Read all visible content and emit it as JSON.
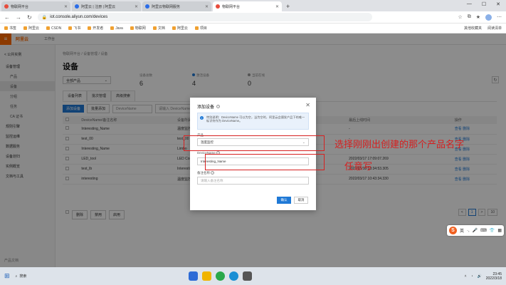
{
  "browser": {
    "tabs": [
      {
        "title": "物联网平台",
        "active": false
      },
      {
        "title": "阿里云 | 注册 | 阿里云",
        "active": false
      },
      {
        "title": "阿里云物联网服务",
        "active": false
      },
      {
        "title": "物联网平台",
        "active": true
      }
    ],
    "url": "iot.console.aliyun.com/devices",
    "bookmarks": [
      "书签",
      "阿里云",
      "CSDN",
      "飞书",
      "开发者",
      "Java",
      "物联网",
      "文档",
      "阿里云",
      "项目"
    ],
    "other_bookmarks": "其他收藏夹",
    "reading_list": "阅读清单"
  },
  "console": {
    "logo": "阿里云",
    "workspace": "工作台"
  },
  "sidebar": {
    "back": "< 公共实例",
    "items": [
      {
        "label": "设备管理",
        "sub": false,
        "active": false
      },
      {
        "label": "产品",
        "sub": true,
        "active": false
      },
      {
        "label": "设备",
        "sub": true,
        "active": true
      },
      {
        "label": "分组",
        "sub": true,
        "active": false
      },
      {
        "label": "任务",
        "sub": true,
        "active": false
      },
      {
        "label": "CA 证书",
        "sub": true,
        "active": false
      },
      {
        "label": "规则引擎",
        "sub": false,
        "active": false
      },
      {
        "label": "监控运维",
        "sub": false,
        "active": false
      },
      {
        "label": "数据服务",
        "sub": false,
        "active": false
      },
      {
        "label": "设备划归",
        "sub": false,
        "active": false
      },
      {
        "label": "实例概览",
        "sub": false,
        "active": false
      },
      {
        "label": "文档与工具",
        "sub": false,
        "active": false
      }
    ],
    "footer": "产品文档"
  },
  "page": {
    "breadcrumb": "物联网平台 / 设备管理 / 设备",
    "title": "设备",
    "product_select": "全部产品",
    "stats": [
      {
        "label": "设备总数",
        "value": "6"
      },
      {
        "label": "激活设备",
        "value": "4"
      },
      {
        "label": "当前在线",
        "value": "0"
      }
    ],
    "subtabs": [
      "设备列表",
      "批次管理",
      "高级搜索"
    ],
    "toolbar": {
      "add_button": "添加设备",
      "batch_button": "批量添加",
      "filter_name": "DeviceName",
      "filter_placeholder": "请输入 DeviceName"
    },
    "table": {
      "headers": [
        "",
        "DeviceName/备注名称",
        "设备所属产品",
        "节点类型",
        "状态/启用状态",
        "最后上线时间",
        "操作"
      ],
      "rows": [
        [
          "",
          "Interesting_Name",
          "温度监控",
          "直连设备",
          "● 未激活",
          "-",
          "查看 删除"
        ],
        [
          "",
          "test_00",
          "test_00",
          "直连设备",
          "● 离线",
          "-",
          "查看 删除"
        ],
        [
          "",
          "Interesting_Name",
          "Limbo",
          "直连设备",
          "● 离线",
          "-",
          "查看 删除"
        ],
        [
          "",
          "LED_tool",
          "LED Control",
          "直连设备",
          "● 离线",
          "2022/03/17 17:09:07.269",
          "查看 删除"
        ],
        [
          "",
          "test_lb",
          "Interesting_Sai",
          "直连设备",
          "● 离线",
          "2022/03/18 13:34:53.305",
          "查看 删除"
        ],
        [
          "",
          "interesting",
          "温度监控",
          "直连设备",
          "● 离线",
          "2022/03/17 10:43:34.330",
          "查看 删除"
        ]
      ]
    },
    "batch_actions": [
      "删除",
      "禁用",
      "启用"
    ],
    "pager": {
      "prev": "<",
      "current": "1",
      "next": ">",
      "size": "10"
    }
  },
  "modal": {
    "title": "添加设备",
    "notice": "特别说明：DeviceName 可以为空，当为空时，阿里云会颁发产品下的唯一标识符作为 DeviceName。",
    "product_label": "产品",
    "product_value": "温度监控",
    "devicename_label": "DeviceName",
    "devicename_value": "Interesting_Name",
    "remark_label": "备注名称",
    "remark_placeholder": "请输入备注名称",
    "ok": "确认",
    "cancel": "取消"
  },
  "annotations": {
    "select_product": "选择刚刚出创建的那个产品名字",
    "any_fill": "任意写"
  },
  "ime": {
    "label": "英",
    "logo": "S"
  },
  "taskbar": {
    "search": "搜索",
    "time": "23:45",
    "date": "2022/3/18"
  },
  "colors": {
    "aliyun_orange": "#ff6a00",
    "primary_blue": "#1f79d6",
    "annotation_red": "#d62020"
  }
}
